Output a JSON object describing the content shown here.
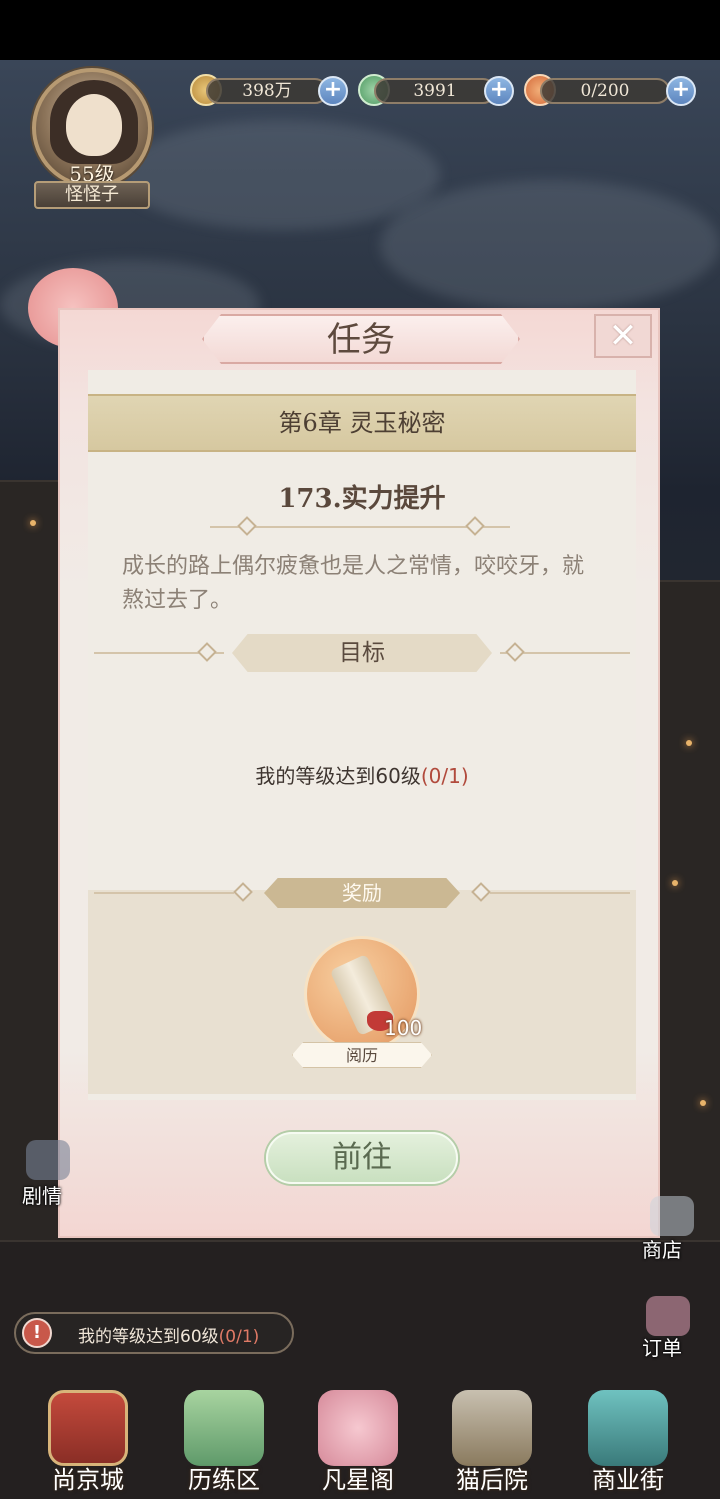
{
  "player": {
    "level": "55级",
    "name": "怪怪子"
  },
  "resources": [
    {
      "icon": "paw-coin-icon",
      "value": "398万"
    },
    {
      "icon": "jade-dragon-icon",
      "value": "3991"
    },
    {
      "icon": "food-bun-icon",
      "value": "0/200"
    }
  ],
  "dialog": {
    "title": "任务",
    "close_icon": "close-icon",
    "chapter": "第6章 灵玉秘密",
    "quest_title": "173.实力提升",
    "description": "成长的路上偶尔疲惫也是人之常情，咬咬牙，就熬过去了。",
    "goal_heading": "目标",
    "goal_text": "我的等级达到60级",
    "goal_progress": "(0/1)",
    "reward_heading": "奖励",
    "reward": {
      "icon": "scroll-icon",
      "count": "100",
      "name": "阅历"
    },
    "go_button": "前往"
  },
  "status_bar": {
    "text": "我的等级达到60级",
    "progress": "(0/1)"
  },
  "side_buttons": {
    "left": "剧情",
    "shop": "商店",
    "orders": "订单"
  },
  "nav": [
    {
      "label": "尚京城",
      "icon": "palace-icon"
    },
    {
      "label": "历练区",
      "icon": "mountain-icon"
    },
    {
      "label": "凡星阁",
      "icon": "cherry-tree-icon"
    },
    {
      "label": "猫后院",
      "icon": "cat-basket-icon"
    },
    {
      "label": "商业街",
      "icon": "gate-icon"
    }
  ],
  "colors": {
    "accent_red": "#b14a3c",
    "banner_gold": "#d6c8a0",
    "modal_pink": "#f3d9d5",
    "button_green": "#c9e0c0"
  }
}
